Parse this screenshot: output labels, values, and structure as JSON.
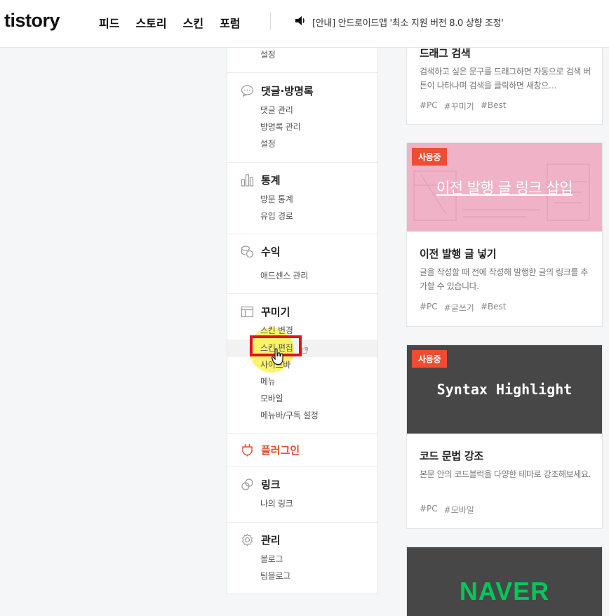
{
  "header": {
    "logo": "tistory",
    "nav": [
      "피드",
      "스토리",
      "스킨",
      "포럼"
    ],
    "notice": "[안내] 안드로이드앱 '최소 지원 버전 8.0 상향 조정'"
  },
  "sidebar": {
    "top_item": "설정",
    "sections": [
      {
        "title": "댓글·방명록",
        "icon": "comment-icon",
        "items": [
          "댓글 관리",
          "방명록 관리",
          "설정"
        ]
      },
      {
        "title": "통계",
        "icon": "chart-icon",
        "items": [
          "방문 통계",
          "유입 경로"
        ]
      },
      {
        "title": "수익",
        "icon": "coin-icon",
        "items": [
          "애드센스 관리"
        ]
      },
      {
        "title": "꾸미기",
        "icon": "layout-icon",
        "items": [
          "스킨 변경",
          "스킨 편집",
          "사이드바",
          "메뉴",
          "모바일",
          "메뉴바/구독 설정"
        ]
      },
      {
        "title": "플러그인",
        "icon": "plug-icon"
      },
      {
        "title": "링크",
        "icon": "link-icon",
        "items": [
          "나의 링크"
        ]
      },
      {
        "title": "관리",
        "icon": "gear-icon",
        "items": [
          "블로그",
          "팀블로그"
        ]
      }
    ],
    "active_item": "스킨 편집"
  },
  "cards": [
    {
      "title": "드래그 검색",
      "desc": "검색하고 싶은 문구를 드래그하면 자동으로 검색 버튼이 나타나며 검색을 클릭하면 새창으…",
      "tags": [
        "#PC",
        "#꾸미기",
        "#Best"
      ]
    },
    {
      "badge": "사용중",
      "thumb_text": "이전 발행 글 링크 삽입",
      "thumb_color": "#f0b2c6",
      "title": "이전 발행 글 넣기",
      "desc": "글을 작성할 때 전에 작성해 발행한 글의 링크를 추가할 수 있습니다.",
      "tags": [
        "#PC",
        "#글쓰기",
        "#Best"
      ]
    },
    {
      "badge": "사용중",
      "thumb_text": "Syntax Highlight",
      "thumb_color": "#474747",
      "title": "코드 문법 강조",
      "desc": "본문 안의 코드블럭을 다양한 테마로 강조해보세요.",
      "tags": [
        "#PC",
        "#모바일"
      ]
    },
    {
      "thumb_text": "NAVER",
      "thumb_color": "#474747",
      "brand_color": "#03c75a"
    }
  ],
  "colors": {
    "accent": "#ef4c34",
    "plugin_red": "#e04b2e",
    "highlight_box": "#e3101d"
  }
}
